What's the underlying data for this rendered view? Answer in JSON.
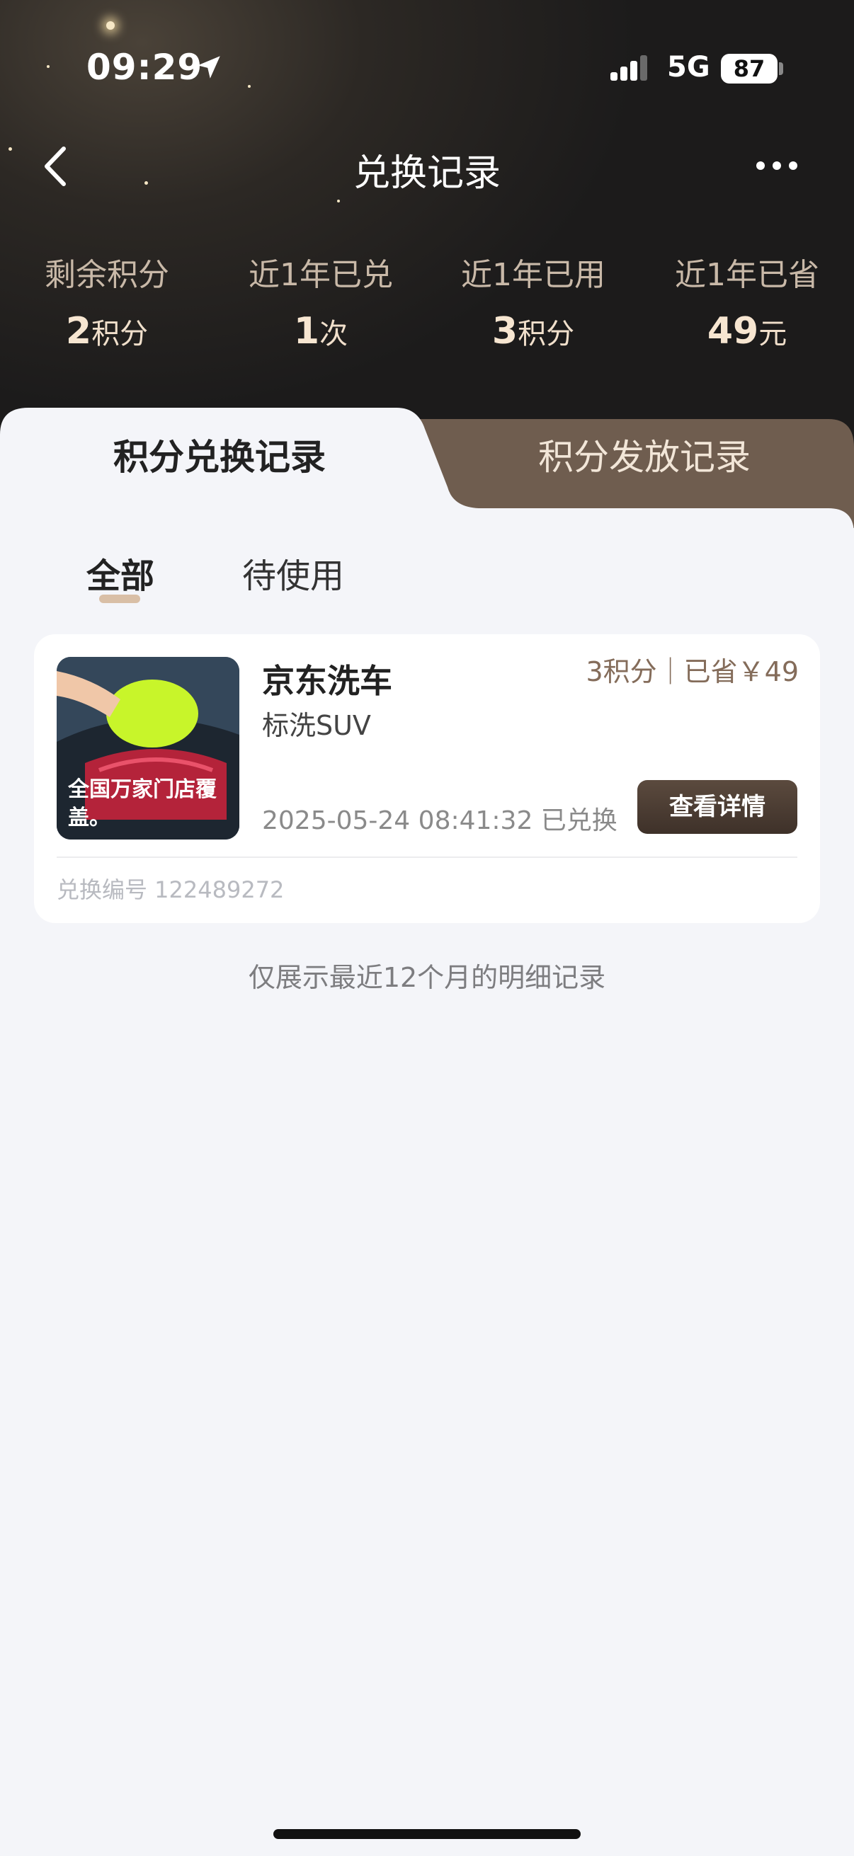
{
  "status_bar": {
    "time": "09:29",
    "network": "5G",
    "battery": "87",
    "icons": [
      "location-arrow-icon",
      "signal-bars-icon"
    ]
  },
  "nav": {
    "title": "兑换记录",
    "icons": [
      "back-chevron-icon",
      "more-dots-icon"
    ]
  },
  "stats": [
    {
      "label": "剩余积分",
      "num": "2",
      "unit": "积分"
    },
    {
      "label": "近1年已兑",
      "num": "1",
      "unit": "次"
    },
    {
      "label": "近1年已用",
      "num": "3",
      "unit": "积分"
    },
    {
      "label": "近1年已省",
      "num": "49",
      "unit": "元"
    }
  ],
  "tabs": {
    "active": "积分兑换记录",
    "inactive": "积分发放记录"
  },
  "filters": {
    "all": "全部",
    "pending": "待使用"
  },
  "record": {
    "image_caption": "全国万家门店覆盖。",
    "name": "京东洗车",
    "subtitle": "标洗SUV",
    "price": "3积分｜已省￥49",
    "date_status": "2025-05-24 08:41:32 已兑换",
    "button": "查看详情",
    "code": "兑换编号 122489272"
  },
  "footer_note": "仅展示最近12个月的明细记录",
  "colors": {
    "page_bg": "#f4f5f9",
    "header_dark": "#1c1b1b",
    "accent_brown": "#6f5d4f",
    "stat_gold": "#f7e6d1",
    "button_brown": "#4a3c32"
  }
}
